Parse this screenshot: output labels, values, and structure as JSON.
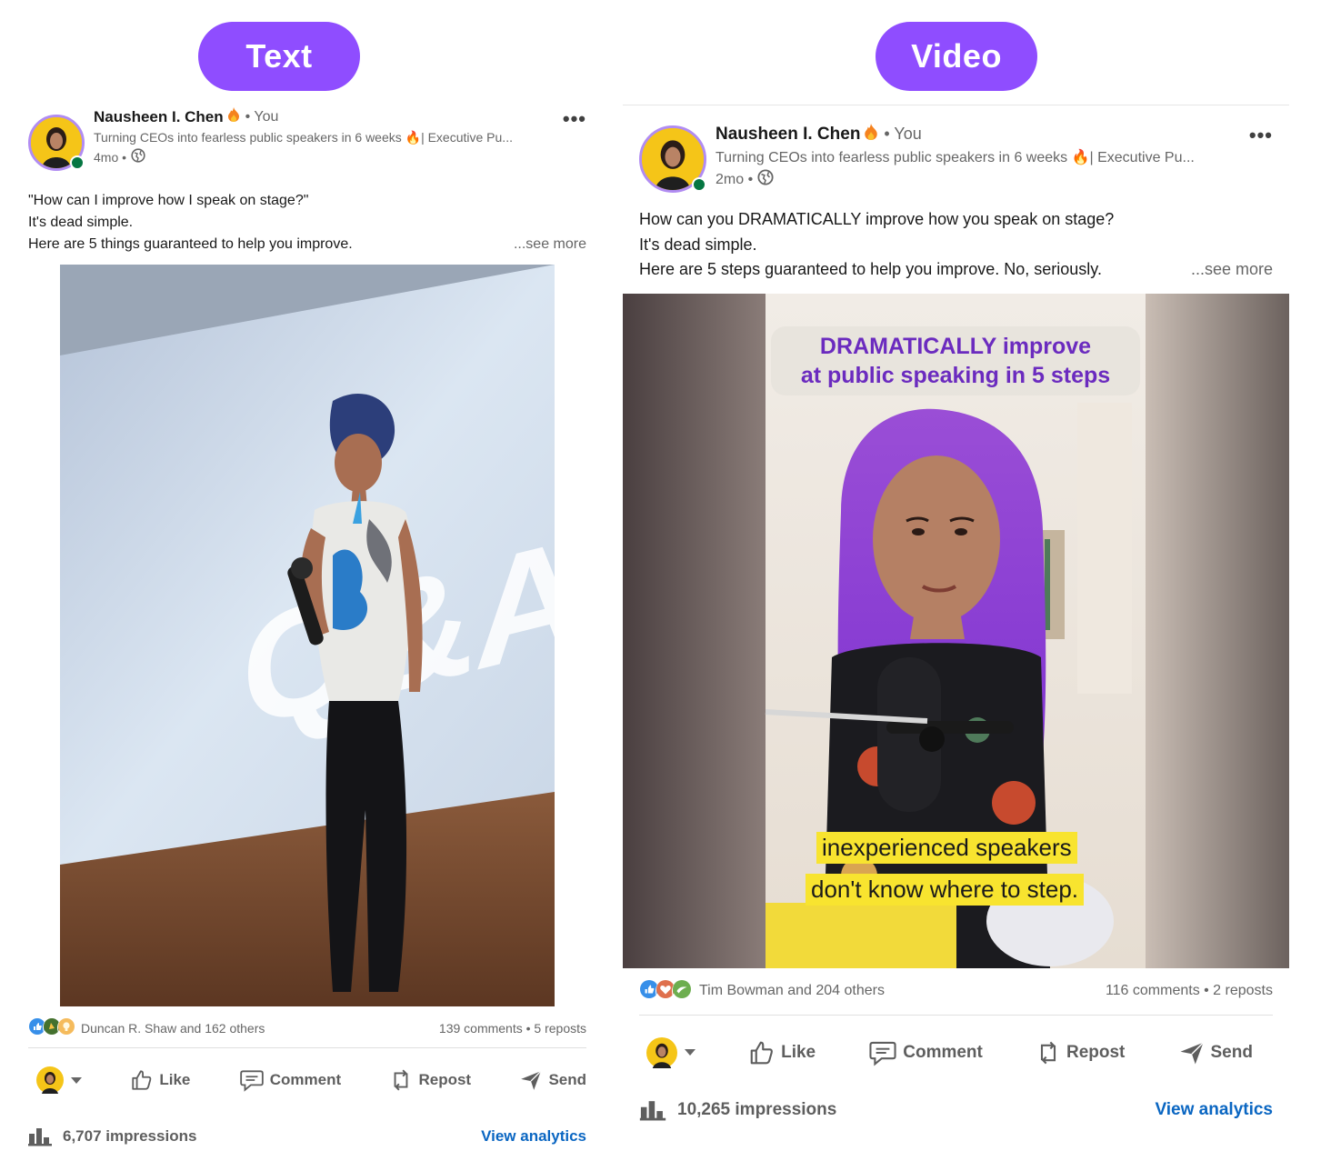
{
  "labels": {
    "left_pill": "Text",
    "right_pill": "Video"
  },
  "left_post": {
    "author": "Nausheen I. Chen",
    "you": "• You",
    "headline": "Turning CEOs into fearless public speakers in 6 weeks 🔥| Executive Pu...",
    "time": "4mo •",
    "body_lines": [
      "\"How can I improve how I speak on stage?\"",
      "It's dead simple.",
      "Here are 5 things guaranteed to help you improve."
    ],
    "see_more": "...see more",
    "image_screen_text": "Q&A",
    "reactions_text": "Duncan R. Shaw and 162 others",
    "comments_reposts": "139 comments • 5 reposts",
    "actions": {
      "like": "Like",
      "comment": "Comment",
      "repost": "Repost",
      "send": "Send"
    },
    "impressions": "6,707 impressions",
    "view_analytics": "View analytics"
  },
  "right_post": {
    "author": "Nausheen I. Chen",
    "you": "• You",
    "headline": "Turning CEOs into fearless public speakers in 6 weeks 🔥| Executive Pu...",
    "time": "2mo •",
    "body_lines": [
      "How can you DRAMATICALLY improve how you speak on stage?",
      "It's dead simple.",
      "Here are 5 steps guaranteed to help you improve. No, seriously."
    ],
    "see_more": "...see more",
    "video_title_line1": "DRAMATICALLY improve",
    "video_title_line2": "at public speaking in 5 steps",
    "subtitle_line1": "inexperienced speakers",
    "subtitle_line2": "don't know where to step.",
    "reactions_text": "Tim Bowman and 204 others",
    "comments_reposts": "116 comments • 2 reposts",
    "actions": {
      "like": "Like",
      "comment": "Comment",
      "repost": "Repost",
      "send": "Send"
    },
    "impressions": "10,265 impressions",
    "view_analytics": "View analytics"
  },
  "colors": {
    "pill": "#8f4dff",
    "link": "#0a66c2",
    "online": "#057642",
    "video_title": "#6b2bbf",
    "subtitle_bg": "#f8e42f"
  }
}
